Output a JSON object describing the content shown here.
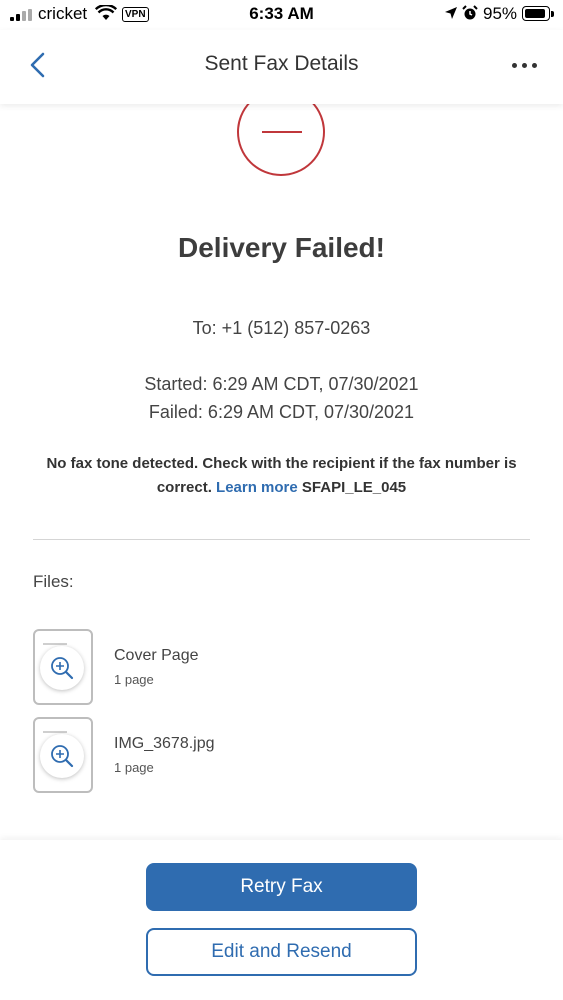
{
  "status_bar": {
    "carrier": "cricket",
    "vpn": "VPN",
    "time": "6:33 AM",
    "battery": "95%"
  },
  "nav": {
    "title": "Sent Fax Details",
    "back_icon": "chevron-left-icon",
    "more_icon": "more-horizontal-icon"
  },
  "status": {
    "icon": "failed-circle-icon",
    "heading": "Delivery Failed!",
    "to": "To: +1 (512) 857-0263",
    "started": "Started: 6:29 AM CDT, 07/30/2021",
    "failed": "Failed: 6:29 AM CDT, 07/30/2021",
    "message": "No fax tone detected. Check with the recipient if the fax number is correct.",
    "learn_more": "Learn more",
    "error_code": "SFAPI_LE_045"
  },
  "files": {
    "label": "Files:",
    "items": [
      {
        "name": "Cover Page",
        "pages": "1 page"
      },
      {
        "name": "IMG_3678.jpg",
        "pages": "1 page"
      }
    ]
  },
  "actions": {
    "retry": "Retry Fax",
    "edit_resend": "Edit and Resend"
  },
  "colors": {
    "accent": "#2f6cb0",
    "error": "#c0373b"
  }
}
